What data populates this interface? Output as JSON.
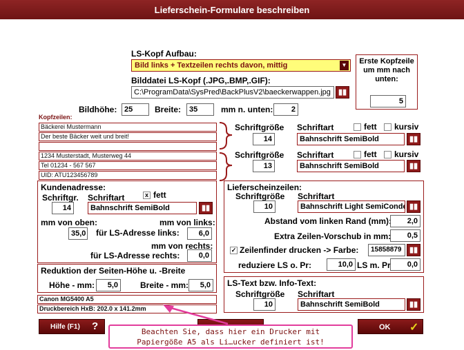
{
  "window": {
    "title": "Lieferschein-Formulare beschreiben"
  },
  "lskopf": {
    "aufbau_label": "LS-Kopf Aufbau:",
    "aufbau_value": "Bild links + Textzeilen rechts davon, mittig",
    "bilddatei_label": "Bilddatei LS-Kopf (.JPG,.BMP,.GIF):",
    "bilddatei_value": "C:\\ProgramData\\SysPred\\BackPlusV2\\baeckerwappen.jpg",
    "bildhoehe_label": "Bildhöhe:",
    "bildhoehe_value": "25",
    "breite_label": "Breite:",
    "breite_value": "35",
    "mm_unten_label": "mm n. unten:",
    "mm_unten_value": "2"
  },
  "erste_kopfzeile": {
    "label": "Erste Kopfzeile um mm nach unten:",
    "value": "5"
  },
  "kopfzeilen": {
    "label": "Kopfzeilen:",
    "group1": [
      "Bäckerei Mustermann",
      "Der beste Bäcker weit und breit!",
      ""
    ],
    "group2": [
      "1234 Musterstadt, Musterweg 44",
      "Tel 01234 - 567 567",
      "UID: ATU123456789"
    ],
    "schriftgroesse_label": "Schriftgröße",
    "schriftart_label": "Schriftart",
    "fett_label": "fett",
    "kursiv_label": "kursiv",
    "group1_size": "14",
    "group1_font": "Bahnschrift SemiBold",
    "group2_size": "13",
    "group2_font": "Bahnschrift SemiBold"
  },
  "kundenadresse": {
    "label": "Kundenadresse:",
    "schriftgr_label": "Schriftgr.",
    "schriftart_label": "Schriftart",
    "fett_label": "fett",
    "fett_checked": "x",
    "size": "14",
    "font": "Bahnschrift SemiBold",
    "mm_von_oben_label": "mm von oben:",
    "mm_von_oben_value": "35,0",
    "mm_von_links_label": "mm von links:",
    "fuer_adresse_links_label": "für LS-Adresse links:",
    "links_value": "6,0",
    "mm_von_rechts_label": "mm von rechts:",
    "fuer_adresse_rechts_label": "für LS-Adresse rechts:",
    "rechts_value": "0,0"
  },
  "reduktion": {
    "label": "Reduktion der Seiten-Höhe u. -Breite",
    "hoehe_label": "Höhe - mm:",
    "hoehe_value": "5,0",
    "breite_label": "Breite - mm:",
    "breite_value": "5,0"
  },
  "drucker": {
    "name": "Canon MG5400 A5",
    "bereich": "Druckbereich HxB: 202.0 x 141.2mm"
  },
  "lieferscheinzeilen": {
    "label": "Lieferscheinzeilen:",
    "schriftgroesse_label": "Schriftgröße",
    "schriftart_label": "Schriftart",
    "size": "10",
    "font": "Bahnschrift Light SemiCondensed",
    "abstand_label": "Abstand vom linken Rand (mm):",
    "abstand_value": "2,0",
    "extra_label": "Extra Zeilen-Vorschub in mm:",
    "extra_value": "0,5",
    "zeilenfinder_check": "✓",
    "zeilenfinder_label": "Zeilenfinder drucken -> Farbe:",
    "zeilenfinder_value": "15858879",
    "reduziere_label": "reduziere LS o. Pr:",
    "reduziere_value": "10,0",
    "lsmpr_label": "LS m. Pr:",
    "lsmpr_value": "0,0"
  },
  "lstext": {
    "label": "LS-Text bzw. Info-Text:",
    "schriftgroesse_label": "Schriftgröße",
    "schriftart_label": "Schriftart",
    "size": "10",
    "font": "Bahnschrift SemiBold"
  },
  "footer": {
    "hilfe_label": "Hilfe (F1)",
    "hilfe_icon": "?",
    "ok_label": "OK",
    "ok_icon": "✓"
  },
  "tooltip": {
    "line1": "Beachten Sie, dass hier ein Drucker mit",
    "line2": "Papiergöße A5 als Li…ucker definiert ist!"
  },
  "colors": {
    "accent": "#8e1a1a",
    "dropdown_bg": "#fffd7a",
    "tooltip_border": "#e23c9c"
  }
}
